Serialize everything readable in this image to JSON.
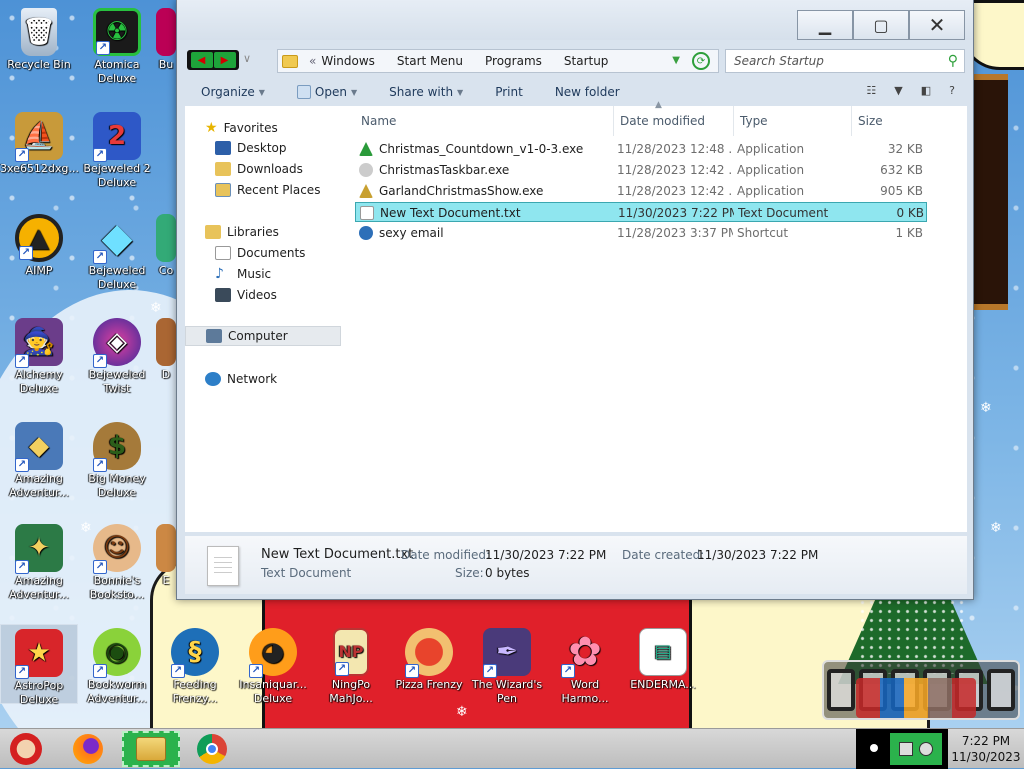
{
  "desktop": {
    "icons": [
      {
        "label": "Recycle Bin",
        "icon": "recycle-bin-icon"
      },
      {
        "label": "Atomica Deluxe",
        "icon": "atomica-icon"
      },
      {
        "label": "Bu",
        "icon": "partial-icon"
      },
      {
        "label": "3xe6512dxg...",
        "icon": "ship-icon"
      },
      {
        "label": "Bejeweled 2 Deluxe",
        "icon": "bejeweled2-icon"
      },
      {
        "label": "AIMP",
        "icon": "aimp-icon"
      },
      {
        "label": "Bejeweled Deluxe",
        "icon": "bejeweled-icon"
      },
      {
        "label": "Co",
        "icon": "partial-icon"
      },
      {
        "label": "Alchemy Deluxe",
        "icon": "wizard-icon"
      },
      {
        "label": "Bejeweled Twist",
        "icon": "bejeweled-twist-icon"
      },
      {
        "label": "D",
        "icon": "partial-icon"
      },
      {
        "label": "Amazing Adventur...",
        "icon": "amazing-adventures-icon"
      },
      {
        "label": "Big Money Deluxe",
        "icon": "money-bag-icon"
      },
      {
        "label": "Amazing Adventur...",
        "icon": "amazing-adventures-2-icon"
      },
      {
        "label": "Bonnie's Booksto...",
        "icon": "bonnie-icon"
      },
      {
        "label": "E",
        "icon": "partial-icon"
      },
      {
        "label": "AstroPop Deluxe",
        "icon": "astropop-icon"
      },
      {
        "label": "Bookworm Adventur...",
        "icon": "bookworm-icon"
      },
      {
        "label": "Feeding Frenzy...",
        "icon": "fish-icon"
      },
      {
        "label": "Insaniquar... Deluxe",
        "icon": "insaniquarium-icon"
      },
      {
        "label": "NingPo MahJo...",
        "icon": "mahjong-icon"
      },
      {
        "label": "Pizza Frenzy",
        "icon": "pizza-icon"
      },
      {
        "label": "The Wizard's Pen",
        "icon": "wizard-pen-icon"
      },
      {
        "label": "Word Harmo...",
        "icon": "flower-icon"
      },
      {
        "label": "ENDERMA...",
        "icon": "enderman-icon"
      }
    ]
  },
  "explorer": {
    "address": {
      "separator": "«",
      "crumbs": [
        "Windows",
        "Start Menu",
        "Programs",
        "Startup"
      ]
    },
    "search_placeholder": "Search Startup",
    "toolbar": {
      "organize": "Organize",
      "open": "Open",
      "share_with": "Share with",
      "print": "Print",
      "new_folder": "New folder"
    },
    "nav": {
      "favorites": "Favorites",
      "desktop": "Desktop",
      "downloads": "Downloads",
      "recent_places": "Recent Places",
      "libraries": "Libraries",
      "documents": "Documents",
      "music": "Music",
      "videos": "Videos",
      "computer": "Computer",
      "network": "Network"
    },
    "columns": {
      "name": "Name",
      "date": "Date modified",
      "type": "Type",
      "size": "Size"
    },
    "files": [
      {
        "name": "Christmas_Countdown_v1-0-3.exe",
        "date": "11/28/2023 12:48 ...",
        "type": "Application",
        "size": "32 KB"
      },
      {
        "name": "ChristmasTaskbar.exe",
        "date": "11/28/2023 12:42 ...",
        "type": "Application",
        "size": "632 KB"
      },
      {
        "name": "GarlandChristmasShow.exe",
        "date": "11/28/2023 12:42 ...",
        "type": "Application",
        "size": "905 KB"
      },
      {
        "name": "New Text Document.txt",
        "date": "11/30/2023 7:22 PM",
        "type": "Text Document",
        "size": "0 KB"
      },
      {
        "name": "sexy email",
        "date": "11/28/2023 3:37 PM",
        "type": "Shortcut",
        "size": "1 KB"
      }
    ],
    "details": {
      "name": "New Text Document.txt",
      "kind": "Text Document",
      "date_modified_label": "Date modified:",
      "date_modified": "11/30/2023 7:22 PM",
      "date_created_label": "Date created:",
      "date_created": "11/30/2023 7:22 PM",
      "size_label": "Size:",
      "size": "0 bytes"
    }
  },
  "taskbar": {
    "apps": [
      "santa-start-icon",
      "firefox-icon",
      "file-explorer-icon",
      "chrome-icon"
    ],
    "clock": {
      "time": "7:22 PM",
      "date": "11/30/2023"
    }
  },
  "colors": {
    "selection": "#8fe6ef",
    "selection_border": "#3ba7b0",
    "accent_green": "#2bb24c"
  }
}
